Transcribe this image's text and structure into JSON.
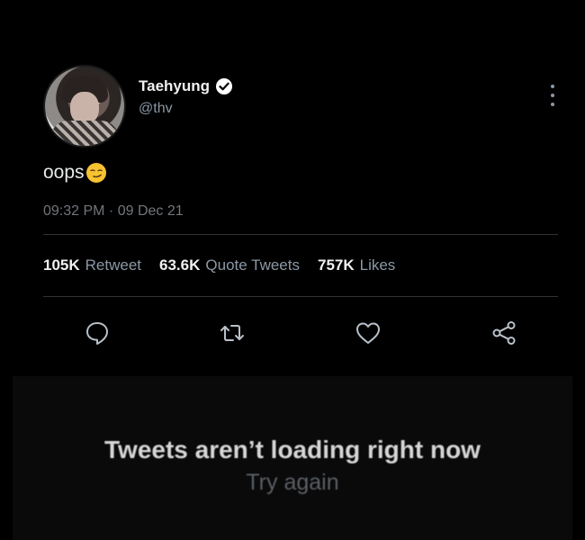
{
  "tweet": {
    "display_name": "Taehyung",
    "handle": "@thv",
    "text": "oops",
    "timestamp": "09:32 PM · 09 Dec 21",
    "stats": {
      "retweets_count": "105K",
      "retweets_label": "Retweet",
      "quotes_count": "63.6K",
      "quotes_label": "Quote Tweets",
      "likes_count": "757K",
      "likes_label": "Likes"
    }
  },
  "error": {
    "title": "Tweets aren’t loading right now",
    "retry": "Try again"
  },
  "colors": {
    "background": "#000000",
    "primary_text": "#e7e9ea",
    "secondary_text": "#8b98a5",
    "divider": "#2f3336"
  },
  "icons": [
    "verified-icon",
    "more-icon",
    "reply-icon",
    "retweet-icon",
    "like-icon",
    "share-icon",
    "smirk-emoji-icon"
  ]
}
